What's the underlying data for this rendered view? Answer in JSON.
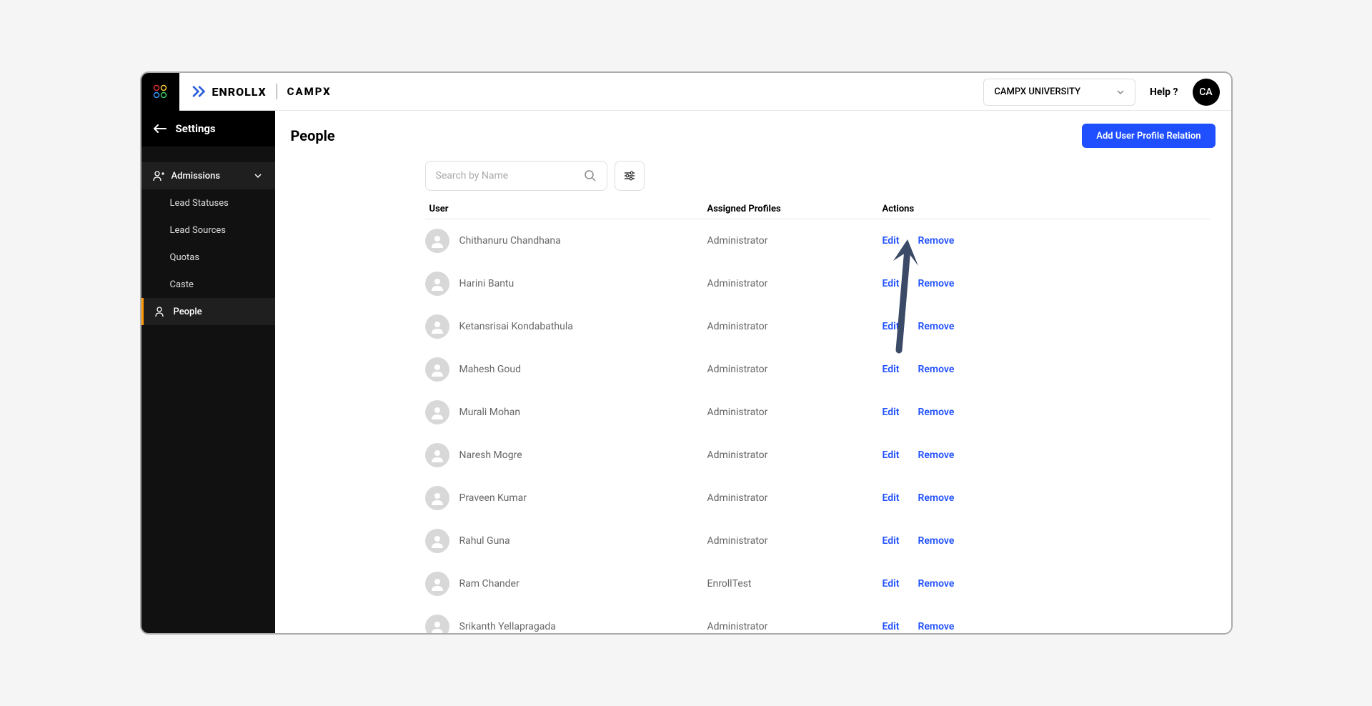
{
  "header": {
    "logo_main": "ENROLLX",
    "logo_secondary": "CAMPX",
    "org_selected": "CAMPX UNIVERSITY",
    "help_label": "Help ?",
    "avatar_initials": "CA"
  },
  "sidebar": {
    "settings_label": "Settings",
    "admissions": {
      "label": "Admissions",
      "items": [
        "Lead Statuses",
        "Lead Sources",
        "Quotas",
        "Caste"
      ]
    },
    "people_label": "People"
  },
  "main": {
    "title": "People",
    "add_button": "Add User Profile Relation",
    "search_placeholder": "Search by Name",
    "columns": {
      "user": "User",
      "profiles": "Assigned Profiles",
      "actions": "Actions"
    },
    "edit_label": "Edit",
    "remove_label": "Remove",
    "rows": [
      {
        "name": "Chithanuru Chandhana",
        "profile": "Administrator"
      },
      {
        "name": "Harini Bantu",
        "profile": "Administrator"
      },
      {
        "name": "Ketansrisai Kondabathula",
        "profile": "Administrator"
      },
      {
        "name": "Mahesh Goud",
        "profile": "Administrator"
      },
      {
        "name": "Murali Mohan",
        "profile": "Administrator"
      },
      {
        "name": "Naresh Mogre",
        "profile": "Administrator"
      },
      {
        "name": "Praveen Kumar",
        "profile": "Administrator"
      },
      {
        "name": "Rahul Guna",
        "profile": "Administrator"
      },
      {
        "name": "Ram Chander",
        "profile": "EnrollTest"
      },
      {
        "name": "Srikanth Yellapragada",
        "profile": "Administrator"
      }
    ]
  }
}
